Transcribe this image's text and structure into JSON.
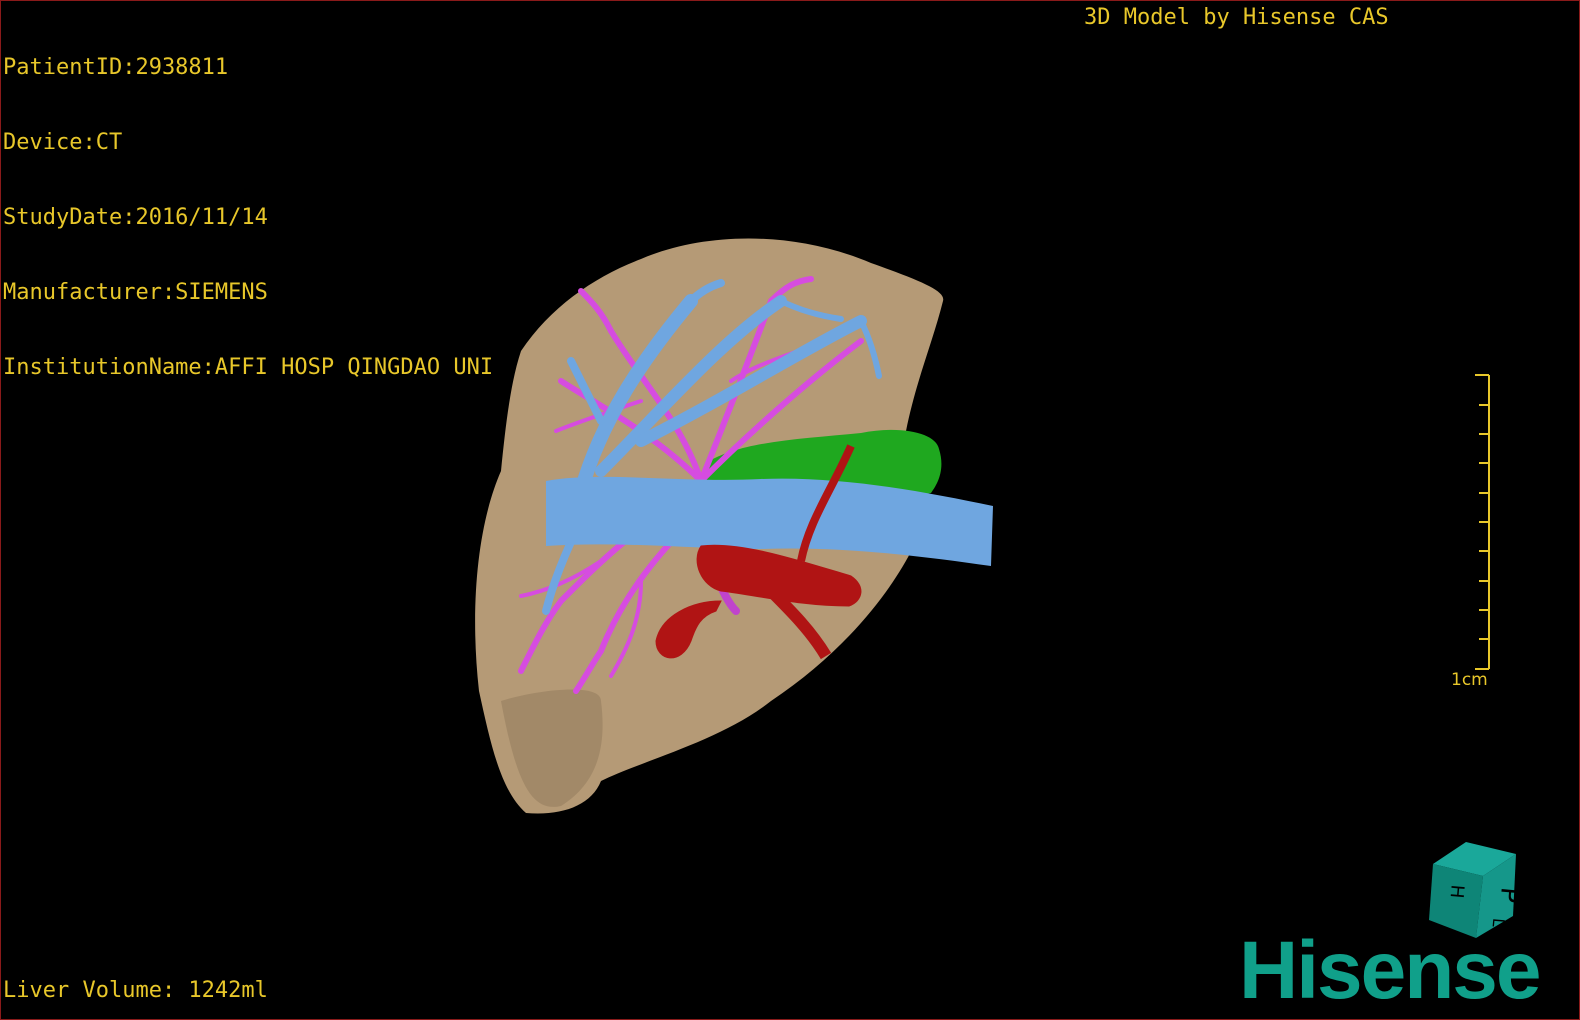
{
  "patient": {
    "lines": [
      "PatientID:2938811",
      "Device:CT",
      "StudyDate:2016/11/14",
      "Manufacturer:SIEMENS",
      "InstitutionName:AFFI HOSP QINGDAO UNI"
    ]
  },
  "credit": "3D Model by Hisense CAS",
  "volume": "Liver Volume: 1242ml",
  "scale": {
    "label": "1cm"
  },
  "cube": {
    "face_front": "P",
    "face_left": "H",
    "face_bottom": "L"
  },
  "brand": "Hisense",
  "colors": {
    "overlay_text": "#e8c72a",
    "liver": "#b59a76",
    "portal_vein": "#6fa6e0",
    "hepatic_artery": "#b01414",
    "biliary": "#d64ce0",
    "stomach_green": "#1fa81f",
    "brand": "#10a08a",
    "border": "#8a1a1a"
  }
}
